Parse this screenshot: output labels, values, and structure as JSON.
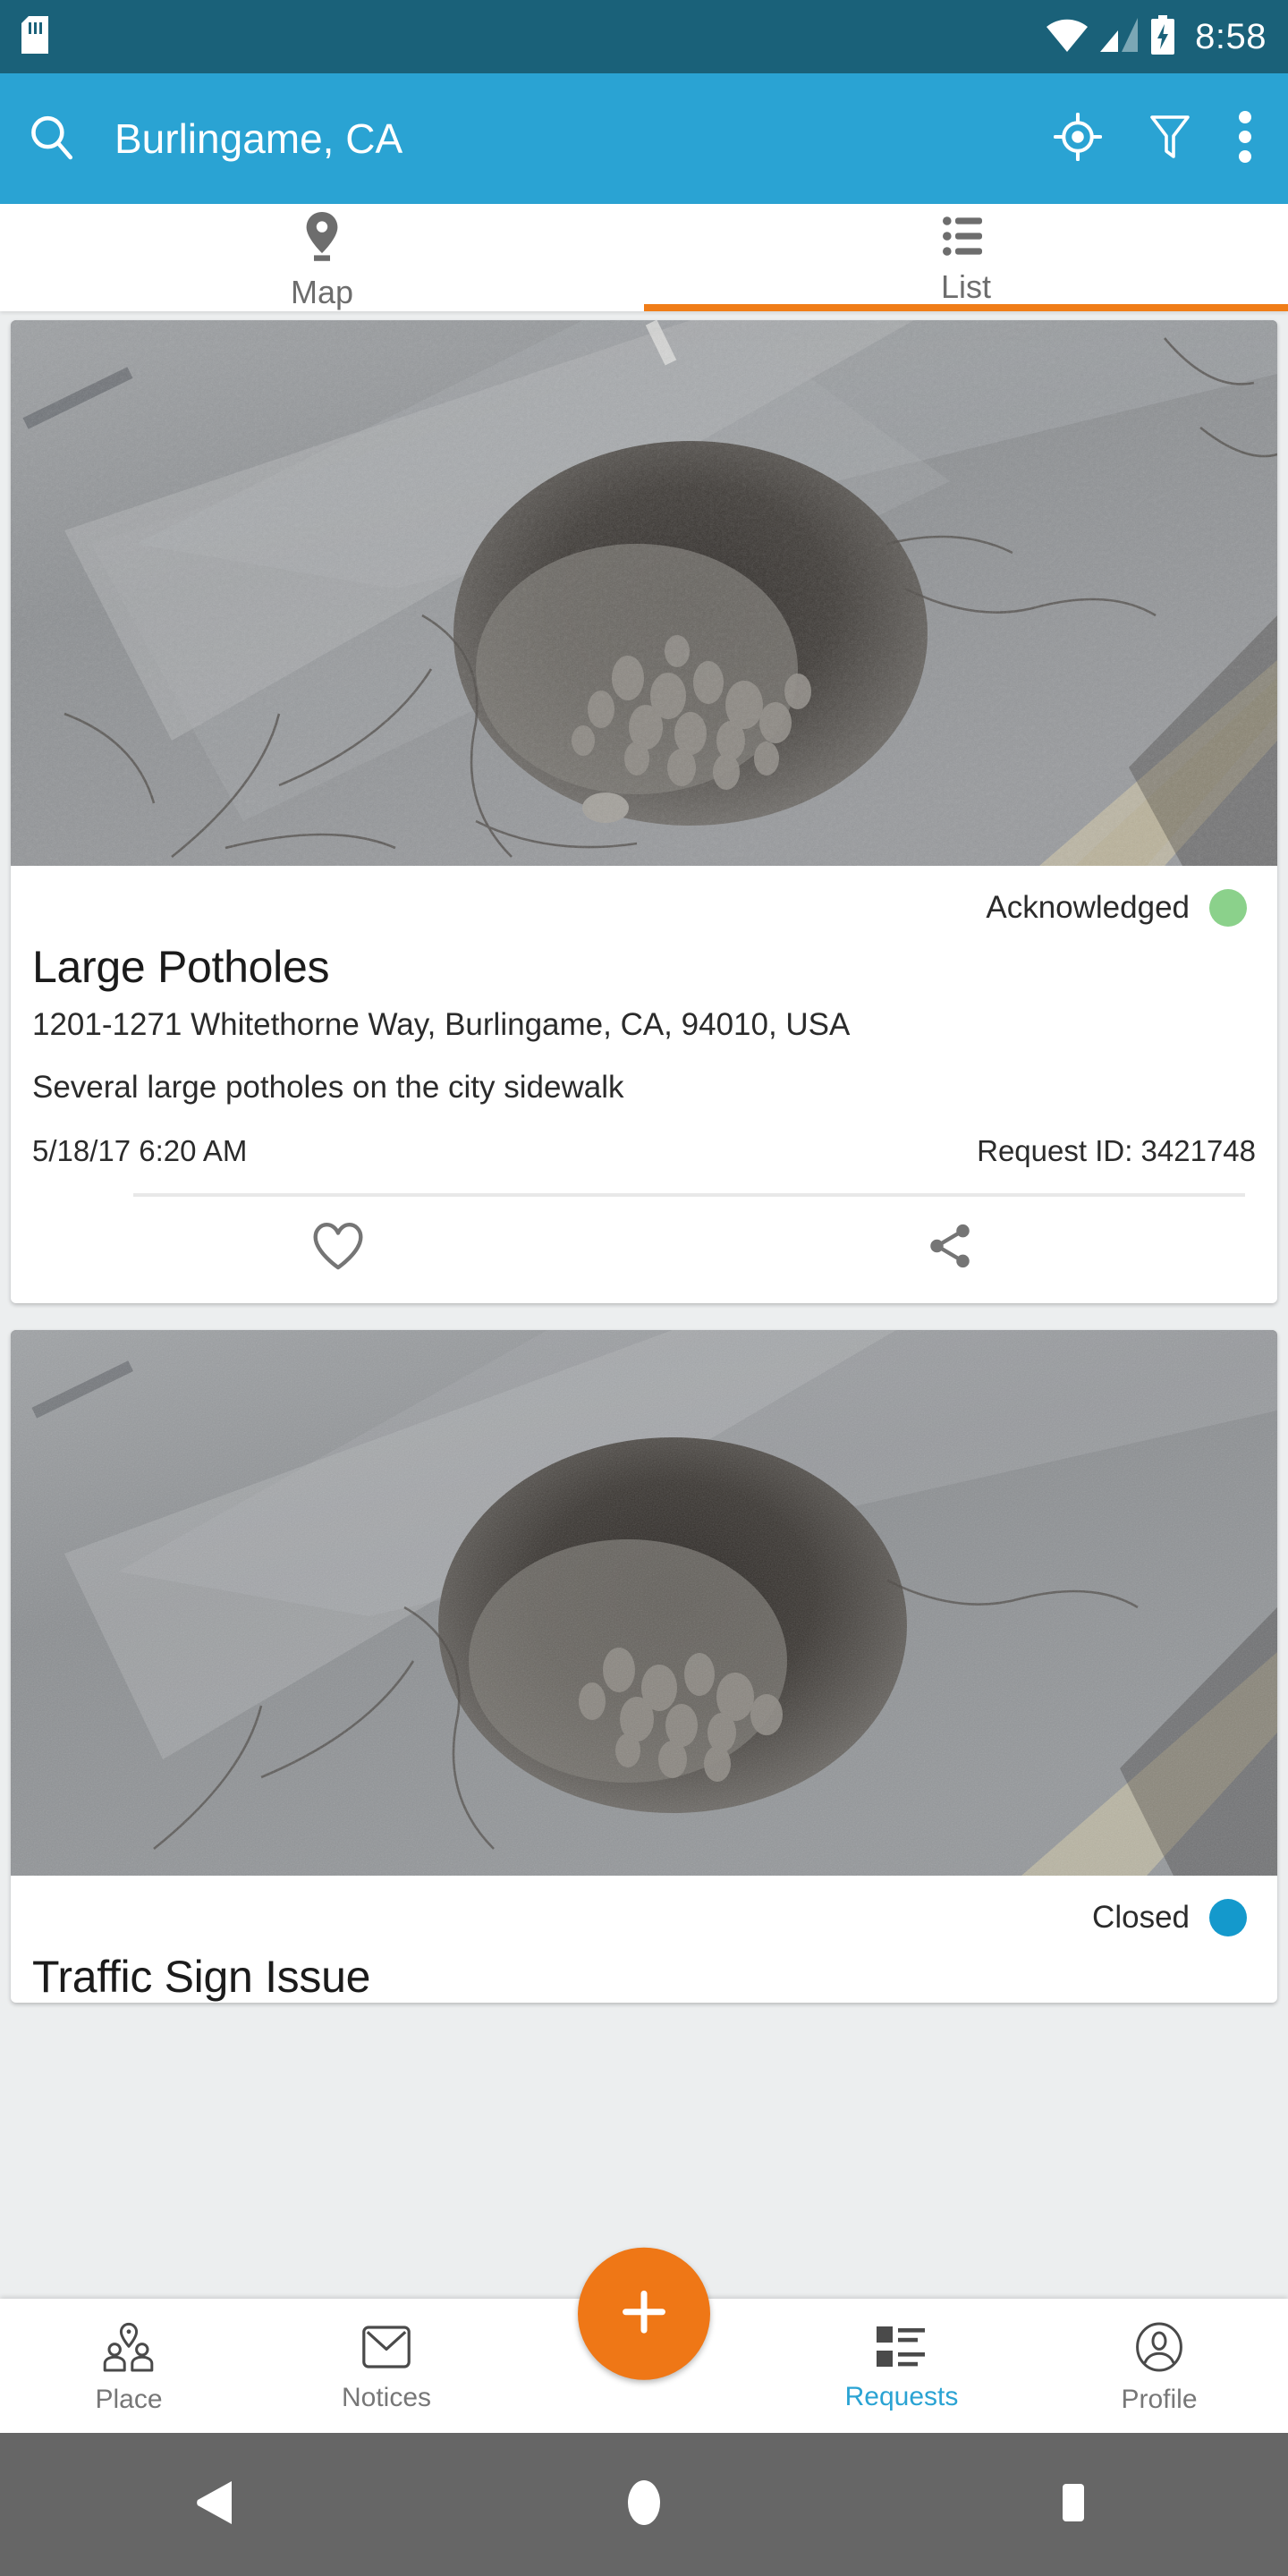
{
  "statusbar": {
    "sdcard_icon": "sdcard-icon",
    "wifi_icon": "wifi-icon",
    "signal_icon": "cell-signal-icon",
    "battery_icon": "battery-charging-icon",
    "clock": "8:58",
    "bg_color": "#1a6179"
  },
  "appbar": {
    "search_icon": "search-icon",
    "title": "Burlingame, CA",
    "locate_icon": "my-location-icon",
    "filter_icon": "filter-icon",
    "overflow_icon": "more-vertical-icon",
    "bg_color": "#2aa3d3"
  },
  "tabs": {
    "active_index": 1,
    "accent_color": "#f07d18",
    "items": [
      {
        "label": "Map",
        "icon": "map-pin-icon",
        "active": false
      },
      {
        "label": "List",
        "icon": "list-icon",
        "active": true
      }
    ]
  },
  "requests": [
    {
      "photo_alt": "pothole-photo",
      "status_label": "Acknowledged",
      "status_color": "#8bd18b",
      "title": "Large Potholes",
      "address": "1201-1271 Whitethorne Way, Burlingame, CA, 94010, USA",
      "description": "Several large potholes on the city sidewalk",
      "timestamp": "5/18/17 6:20 AM",
      "request_id": "Request ID: 3421748",
      "favorite_icon": "heart-icon",
      "share_icon": "share-icon"
    },
    {
      "photo_alt": "pothole-photo",
      "status_label": "Closed",
      "status_color": "#1499cc",
      "title": "Traffic Sign Issue"
    }
  ],
  "bottomnav": {
    "active_color": "#2aa3d3",
    "fab_color": "#ef7716",
    "fab_icon": "plus-icon",
    "items": [
      {
        "label": "Place",
        "icon": "place-people-icon",
        "active": false
      },
      {
        "label": "Notices",
        "icon": "envelope-icon",
        "active": false
      },
      {
        "label": "Requests",
        "icon": "requests-list-icon",
        "active": true
      },
      {
        "label": "Profile",
        "icon": "person-circle-icon",
        "active": false
      }
    ]
  },
  "androidnav": {
    "back_icon": "back-triangle-icon",
    "home_icon": "home-circle-icon",
    "recents_icon": "recents-square-icon",
    "bg_color": "#666666"
  }
}
